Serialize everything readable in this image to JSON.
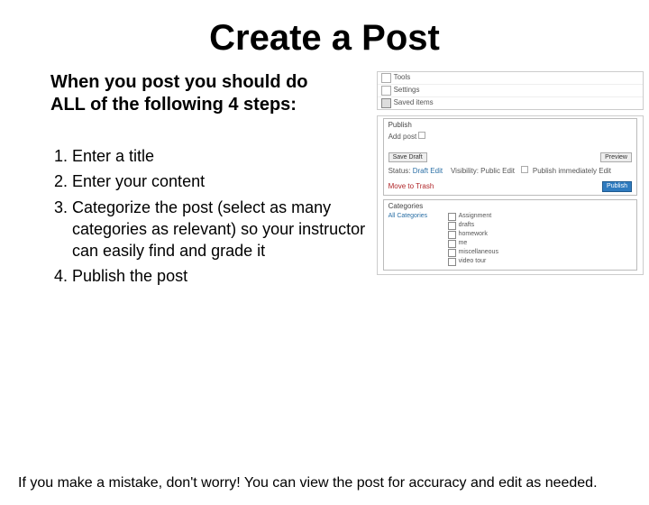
{
  "title": "Create a Post",
  "intro": "When you post you should do ALL of the following 4 steps:",
  "steps": [
    "Enter a title",
    "Enter your content",
    "Categorize the post (select as many categories as relevant) so your instructor can easily find and grade it",
    "Publish the post"
  ],
  "footer": "If you make a mistake, don't worry!  You can view the post for accuracy and edit as needed.",
  "shot": {
    "side": {
      "tools": "Tools",
      "settings": "Settings",
      "saved": "Saved items"
    },
    "pub": {
      "header": "Publish",
      "add_basic": "Add post",
      "save_draft": "Save Draft",
      "preview": "Preview",
      "status": "Status:",
      "draft_edit": "Draft Edit",
      "visibility": "Visibility: Public Edit",
      "pub_imm": "Publish immediately Edit",
      "trash": "Move to Trash",
      "publish_btn": "Publish"
    },
    "cat": {
      "header": "Categories",
      "tab_all": "All Categories",
      "items": [
        "Assignment",
        "drafts",
        "homework",
        "me",
        "miscellaneous",
        "video tour"
      ]
    }
  }
}
